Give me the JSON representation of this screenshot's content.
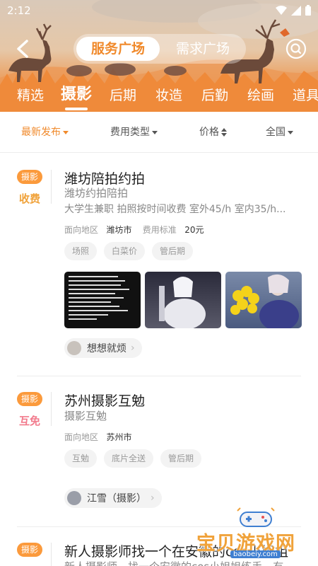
{
  "status": {
    "time": "2:12"
  },
  "header": {
    "segments": {
      "active": "服务广场",
      "inactive": "需求广场"
    },
    "categories": [
      "精选",
      "摄影",
      "后期",
      "妆造",
      "后勤",
      "绘画",
      "道具"
    ],
    "active_category": "摄影"
  },
  "filters": [
    {
      "label": "最新发布",
      "active": true
    },
    {
      "label": "费用类型",
      "active": false
    },
    {
      "label": "价格",
      "active": false
    },
    {
      "label": "全国",
      "active": false
    }
  ],
  "posts": [
    {
      "badge": "摄影",
      "fee_type": "收费",
      "fee_color": "#f0a23a",
      "title": "潍坊陪拍约拍",
      "subtitle": "潍坊约拍陪拍",
      "description": "大学生兼职 拍照按时间收费 室外45/h 室内35/h...",
      "region_label": "面向地区",
      "region": "潍坊市",
      "fee_label": "费用标准",
      "fee_value": "20元",
      "tags": [
        "场照",
        "白菜价",
        "管后期"
      ],
      "user": "想想就烦"
    },
    {
      "badge": "摄影",
      "fee_type": "互免",
      "fee_color": "#f27a8c",
      "title": "苏州摄影互勉",
      "subtitle": "摄影互勉",
      "region_label": "面向地区",
      "region": "苏州市",
      "tags": [
        "互勉",
        "底片全送",
        "管后期"
      ],
      "user": "江雪（摄影）"
    },
    {
      "badge": "摄影",
      "title": "新人摄影师找一个在安徽的cos小姐姐",
      "subtitle": "新人摄影师，找一个安徽的cos小姐姐练手，有"
    }
  ],
  "watermark": {
    "text": "宝贝游戏网",
    "url": "baobeiy.com"
  },
  "colors": {
    "accent": "#f08a2c",
    "badge": "#fb9a3c"
  }
}
